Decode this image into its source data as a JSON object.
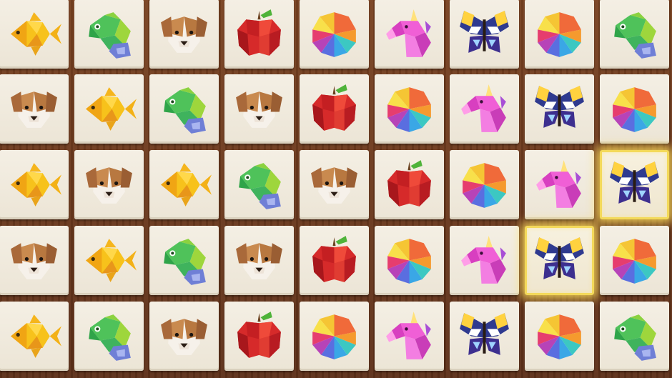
{
  "game": {
    "grid": [
      [
        "goldfish",
        "chameleon",
        "puppy",
        "apple",
        "gem-ball",
        "unicorn",
        "butterfly",
        "gem-ball",
        "chameleon"
      ],
      [
        "puppy",
        "goldfish",
        "chameleon",
        "puppy",
        "apple",
        "gem-ball",
        "unicorn",
        "butterfly",
        "gem-ball"
      ],
      [
        "goldfish",
        "puppy",
        "goldfish",
        "chameleon",
        "puppy",
        "apple",
        "gem-ball",
        "unicorn",
        "butterfly"
      ],
      [
        "puppy",
        "goldfish",
        "chameleon",
        "puppy",
        "apple",
        "gem-ball",
        "unicorn",
        "butterfly",
        "gem-ball"
      ],
      [
        "goldfish",
        "chameleon",
        "puppy",
        "apple",
        "gem-ball",
        "unicorn",
        "butterfly",
        "gem-ball",
        "chameleon"
      ]
    ],
    "selected": [
      [
        2,
        8
      ],
      [
        3,
        7
      ]
    ],
    "colors": {
      "board": "#6b3a1f",
      "tile": "#f0eadc",
      "highlight": "#f3d95a"
    }
  }
}
